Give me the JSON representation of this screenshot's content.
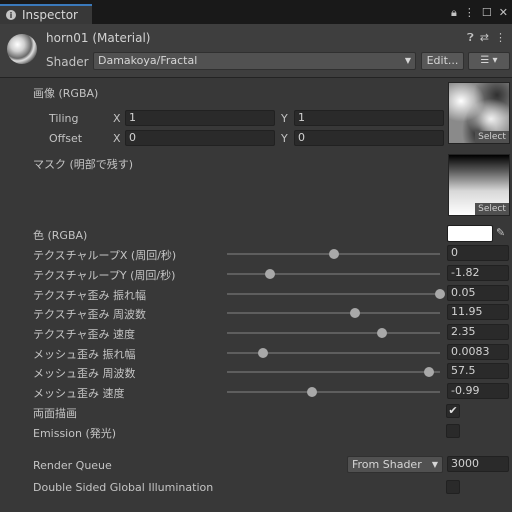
{
  "window": {
    "tab_label": "Inspector",
    "tab_icon": "info-icon",
    "icons": [
      "lock-icon",
      "menu-icon",
      "maximize-icon",
      "close-icon"
    ]
  },
  "header": {
    "material_name": "horn01 (Material)",
    "shader_label": "Shader",
    "shader_value": "Damakoya/Fractal",
    "edit_label": "Edit...",
    "icons": [
      "help-icon",
      "settings-icon",
      "more-icon"
    ],
    "list_icon": "list-icon"
  },
  "main_tex": {
    "label": "画像 (RGBA)",
    "tiling_label": "Tiling",
    "offset_label": "Offset",
    "tiling_x": "1",
    "tiling_y": "1",
    "offset_x": "0",
    "offset_y": "0",
    "x_axis": "X",
    "y_axis": "Y",
    "select_label": "Select"
  },
  "mask_tex": {
    "label": "マスク (明部で残す)",
    "select_label": "Select"
  },
  "color": {
    "label": "色 (RGBA)",
    "value_hex": "#ffffff",
    "picker_icon": "eyedropper-icon"
  },
  "sliders": [
    {
      "label": "テクスチャループX (周回/秒)",
      "value": "0",
      "fraction": 0.5
    },
    {
      "label": "テクスチャループY (周回/秒)",
      "value": "-1.82",
      "fraction": 0.2
    },
    {
      "label": "テクスチャ歪み 振れ幅",
      "value": "0.05",
      "fraction": 1.0
    },
    {
      "label": "テクスチャ歪み 周波数",
      "value": "11.95",
      "fraction": 0.6
    },
    {
      "label": "テクスチャ歪み 速度",
      "value": "2.35",
      "fraction": 0.73
    },
    {
      "label": "メッシュ歪み 振れ幅",
      "value": "0.0083",
      "fraction": 0.17
    },
    {
      "label": "メッシュ歪み 周波数",
      "value": "57.5",
      "fraction": 0.95
    },
    {
      "label": "メッシュ歪み 速度",
      "value": "-0.99",
      "fraction": 0.4
    }
  ],
  "toggles": [
    {
      "label": "両面描画",
      "checked": true
    },
    {
      "label": "Emission (発光)",
      "checked": false
    }
  ],
  "render_queue": {
    "label": "Render Queue",
    "mode": "From Shader",
    "value": "3000"
  },
  "double_sided_gi": {
    "label": "Double Sided Global Illumination",
    "checked": false
  },
  "colors": {
    "background": "#383838",
    "accent": "#3a79bb"
  }
}
